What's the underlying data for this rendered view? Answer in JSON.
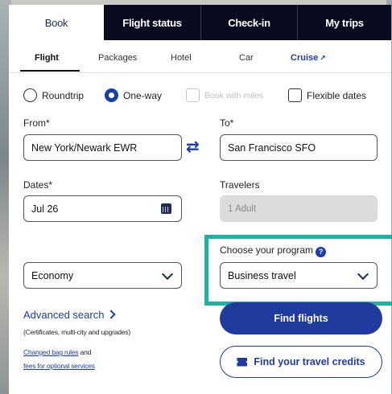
{
  "tabs": [
    {
      "label": "Book",
      "active": true
    },
    {
      "label": "Flight status",
      "active": false
    },
    {
      "label": "Check-in",
      "active": false
    },
    {
      "label": "My trips",
      "active": false
    }
  ],
  "subtabs": {
    "flight": "Flight",
    "packages": "Packages",
    "hotel": "Hotel",
    "car": "Car",
    "cruise": "Cruise",
    "cruise_icon": "external-link-icon"
  },
  "trip_options": {
    "roundtrip": "Roundtrip",
    "oneway": "One-way",
    "miles": "Book with miles",
    "flexible": "Flexible dates",
    "selected": "One-way"
  },
  "from": {
    "label": "From*",
    "value": "New York/Newark EWR"
  },
  "to": {
    "label": "To*",
    "value": "San Francisco SFO"
  },
  "dates": {
    "label": "Dates*",
    "value": "Jul 26"
  },
  "travelers": {
    "label": "Travelers",
    "value": "1 Adult"
  },
  "cabin": {
    "value": "Economy"
  },
  "program": {
    "label": "Choose your program",
    "value": "Business travel",
    "help": "?"
  },
  "advanced": {
    "label": "Advanced search",
    "note": "(Certificates, multi-city and upgrades)",
    "bag_link": "Changed bag rules",
    "and": " and",
    "fees_link": "fees for optional services"
  },
  "buttons": {
    "find_flights": "Find flights",
    "travel_credits": "Find your travel credits"
  },
  "colors": {
    "brand_blue": "#1f3b9e",
    "tab_dark": "#0b0b1f",
    "highlight_teal": "#1fb3a5"
  }
}
